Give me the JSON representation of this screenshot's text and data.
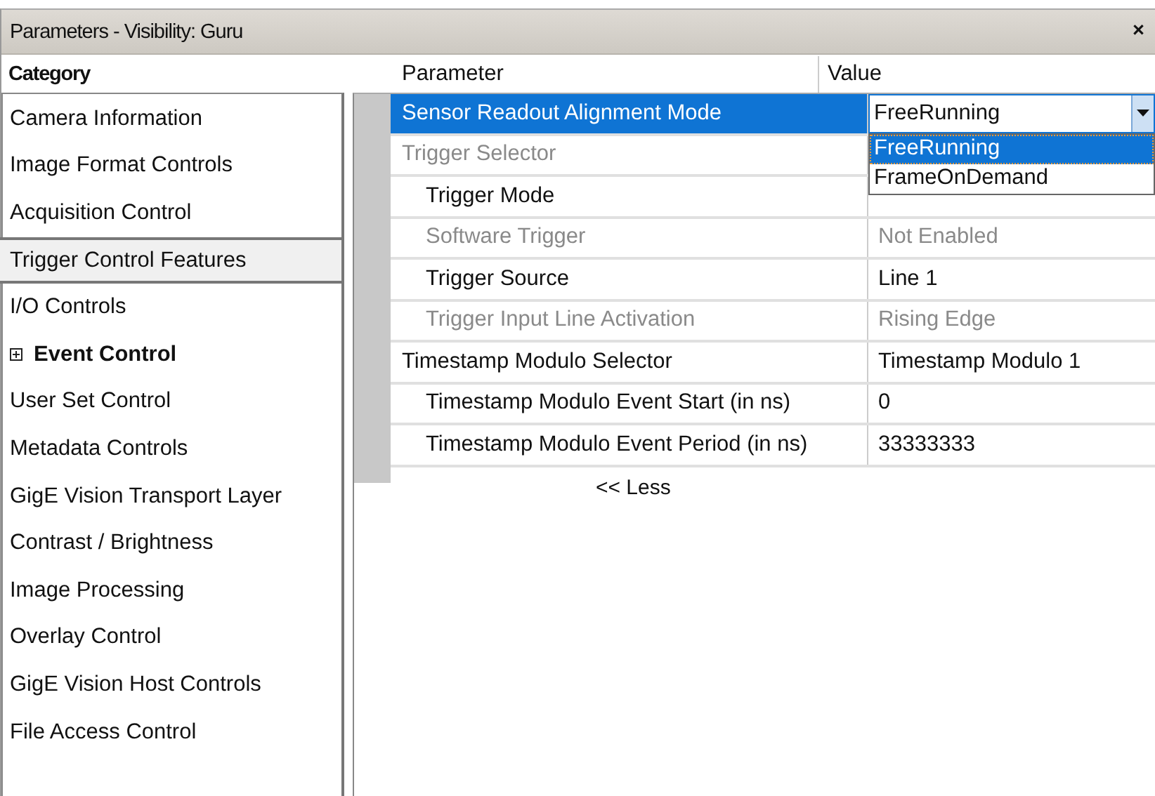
{
  "window": {
    "title": "Parameters - Visibility: Guru",
    "close": "×"
  },
  "categories": {
    "header": "Category",
    "items": [
      {
        "label": "Camera Information",
        "kind": "item",
        "selected": false
      },
      {
        "label": "Image Format Controls",
        "kind": "item",
        "selected": false
      },
      {
        "label": "Acquisition Control",
        "kind": "item",
        "selected": false
      },
      {
        "label": "Trigger Control Features",
        "kind": "item",
        "selected": true
      },
      {
        "label": "I/O Controls",
        "kind": "item",
        "selected": false
      },
      {
        "label": "Event Control",
        "kind": "group",
        "selected": false
      },
      {
        "label": "User Set Control",
        "kind": "item",
        "selected": false
      },
      {
        "label": "Metadata Controls",
        "kind": "item",
        "selected": false
      },
      {
        "label": "GigE Vision Transport Layer",
        "kind": "item",
        "selected": false
      },
      {
        "label": "Contrast / Brightness",
        "kind": "item",
        "selected": false
      },
      {
        "label": "Image Processing",
        "kind": "item",
        "selected": false
      },
      {
        "label": "Overlay Control",
        "kind": "item",
        "selected": false
      },
      {
        "label": "GigE Vision Host Controls",
        "kind": "item",
        "selected": false
      },
      {
        "label": "File Access Control",
        "kind": "item",
        "selected": false
      }
    ]
  },
  "parameters": {
    "columns": [
      "Parameter",
      "Value"
    ],
    "rows": [
      {
        "name": "Sensor Readout Alignment Mode",
        "value": "FreeRunning",
        "disabled": false,
        "selected": true,
        "dropdown": {
          "open": true,
          "options": [
            {
              "label": "FreeRunning",
              "selected": true
            },
            {
              "label": "FrameOnDemand",
              "selected": false
            }
          ]
        }
      },
      {
        "name": "Trigger Selector",
        "disabled": true,
        "selected": false,
        "children": [
          {
            "name": "Trigger Mode",
            "disabled": false,
            "selected": false
          },
          {
            "name": "Software Trigger",
            "value": "Not Enabled",
            "disabled": true,
            "selected": false
          },
          {
            "name": "Trigger Source",
            "value": "Line 1",
            "disabled": false,
            "selected": false
          },
          {
            "name": "Trigger Input Line Activation",
            "value": "Rising Edge",
            "disabled": true,
            "selected": false
          }
        ]
      },
      {
        "name": "Timestamp Modulo Selector",
        "value": "Timestamp Modulo 1",
        "disabled": false,
        "selected": false,
        "children": [
          {
            "name": "Timestamp Modulo Event Start (in ns)",
            "value": "0",
            "disabled": false,
            "selected": false
          },
          {
            "name": "Timestamp Modulo Event Period (in ns)",
            "value": "33333333",
            "disabled": false,
            "selected": false
          }
        ]
      }
    ],
    "less_link": "<< Less"
  }
}
